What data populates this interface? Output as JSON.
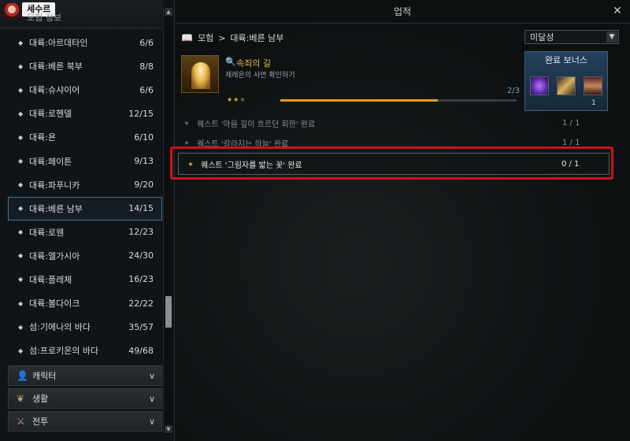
{
  "user": {
    "name": "세수르"
  },
  "left_panel": {
    "section_title": "모험 정보",
    "items": [
      {
        "name": "대륙:아르데타인",
        "count": "6/6"
      },
      {
        "name": "대륙:베른 북부",
        "count": "8/8"
      },
      {
        "name": "대륙:슈샤이어",
        "count": "6/6"
      },
      {
        "name": "대륙:로헨델",
        "count": "12/15"
      },
      {
        "name": "대륙:욘",
        "count": "6/10"
      },
      {
        "name": "대륙:페이튼",
        "count": "9/13"
      },
      {
        "name": "대륙:파푸니카",
        "count": "9/20"
      },
      {
        "name": "대륙:베른 남부",
        "count": "14/15",
        "selected": true
      },
      {
        "name": "대륙:로웬",
        "count": "12/23"
      },
      {
        "name": "대륙:엘가시아",
        "count": "24/30"
      },
      {
        "name": "대륙:플레체",
        "count": "16/23"
      },
      {
        "name": "대륙:볼다이크",
        "count": "22/22"
      },
      {
        "name": "섬:기에나의 바다",
        "count": "35/57"
      },
      {
        "name": "섬:프로키온의 바다",
        "count": "49/68"
      }
    ],
    "categories": [
      {
        "label": "캐릭터",
        "icon": "person-icon"
      },
      {
        "label": "생활",
        "icon": "leaf-icon"
      },
      {
        "label": "전투",
        "icon": "sword-icon"
      }
    ]
  },
  "right_panel": {
    "title": "업적",
    "breadcrumb": {
      "root": "모험",
      "separator": ">",
      "current": "대륙:베른 남부"
    },
    "filter": {
      "selected": "미달성"
    },
    "achievement": {
      "title": "속죄의 길",
      "description": "제레온의 사연 확인하기",
      "progress_text": "2/3",
      "progress": 0.6667,
      "stars": "★★★",
      "stars_filled": 2
    },
    "bonus": {
      "title": "완료 보너스",
      "rewards": [
        {
          "icon": "purple-gem-icon"
        },
        {
          "icon": "golden-horn-icon"
        },
        {
          "icon": "card-icon",
          "count": "1"
        }
      ]
    },
    "conditions": [
      {
        "star": "★",
        "text": "퀘스트 '마음 깊이 흐르던 회한' 완료",
        "progress": "1 / 1",
        "active": false
      },
      {
        "star": "★",
        "text": "퀘스트 '갈라지는 하늘' 완료",
        "progress": "1 / 1",
        "active": false
      },
      {
        "star": "★",
        "text": "퀘스트 '그림자를 밟는 꽃' 완료",
        "progress": "0 / 1",
        "active": true
      }
    ]
  },
  "colors": {
    "highlight": "#d01218",
    "progress_bar": "#e39a1f",
    "accent_gold": "#e7b94d",
    "selection_border": "#4a6f98"
  }
}
